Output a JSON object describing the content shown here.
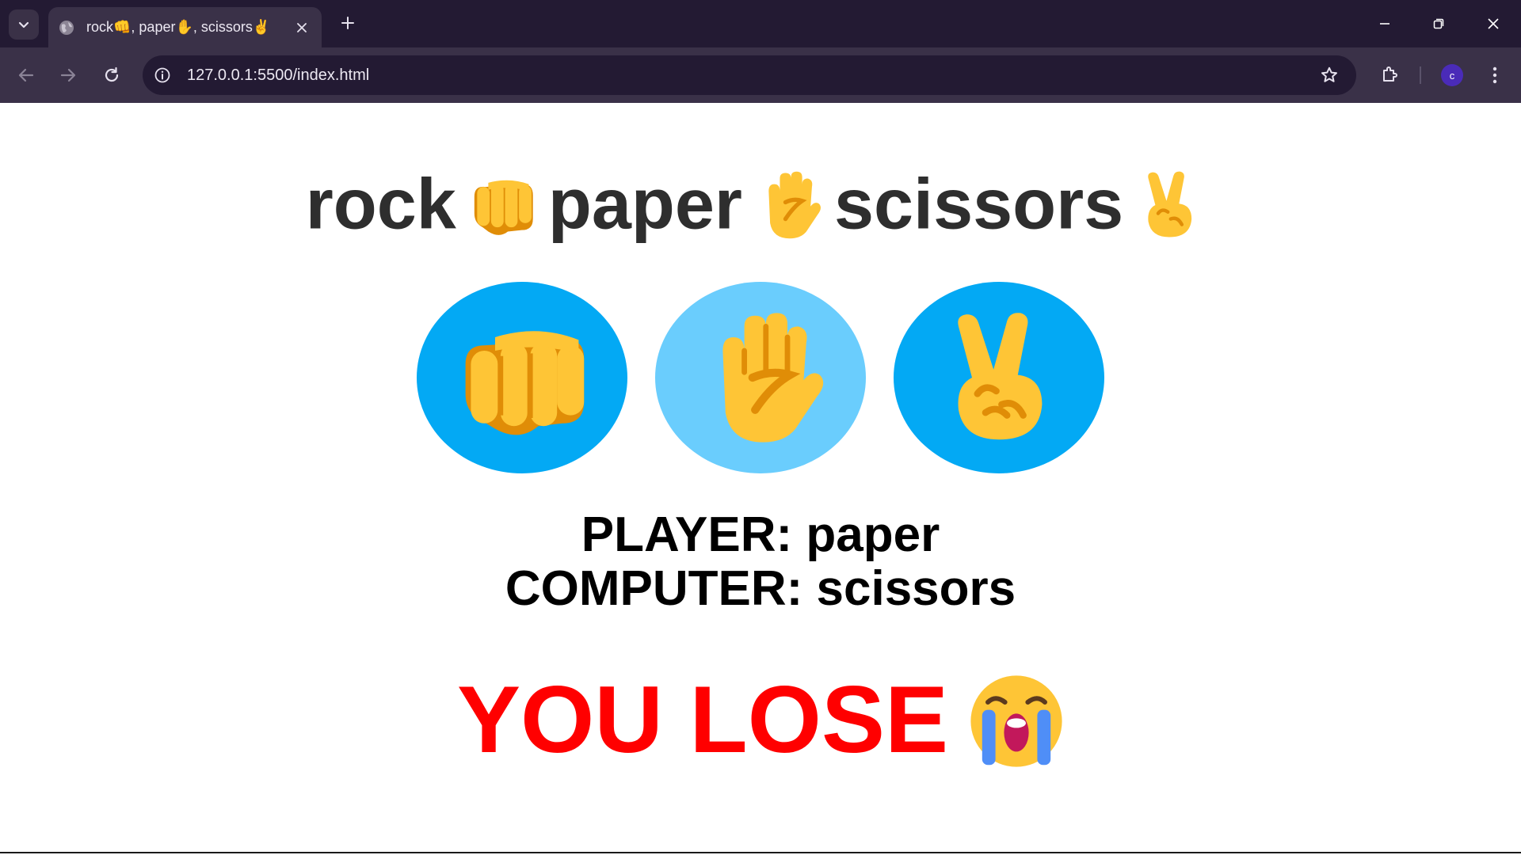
{
  "browser": {
    "tab_title": "rock👊, paper✋, scissors✌",
    "url": "127.0.0.1:5500/index.html",
    "profile_initial": "c",
    "icons": [
      "tab-search-icon",
      "globe-icon",
      "close-icon",
      "plus-icon",
      "minimize-icon",
      "restore-icon",
      "window-close-icon",
      "back-icon",
      "forward-icon",
      "reload-icon",
      "info-icon",
      "star-icon",
      "extensions-icon",
      "kebab-menu-icon"
    ]
  },
  "page": {
    "heading": {
      "rock": "rock",
      "paper": "paper",
      "scissors": "scissors"
    },
    "choices": [
      {
        "name": "rock",
        "icon": "fist-icon",
        "selected": false
      },
      {
        "name": "paper",
        "icon": "raised-hand-icon",
        "selected": true
      },
      {
        "name": "scissors",
        "icon": "victory-hand-icon",
        "selected": false
      }
    ],
    "player_text": "PLAYER: paper",
    "computer_text": "COMPUTER: scissors",
    "result_text": "YOU LOSE",
    "result_icon": "crying-face-icon",
    "colors": {
      "button": "#03a9f4",
      "button_selected": "#6acdfd",
      "result": "#ff0000",
      "emoji_yellow": "#fec536"
    }
  }
}
